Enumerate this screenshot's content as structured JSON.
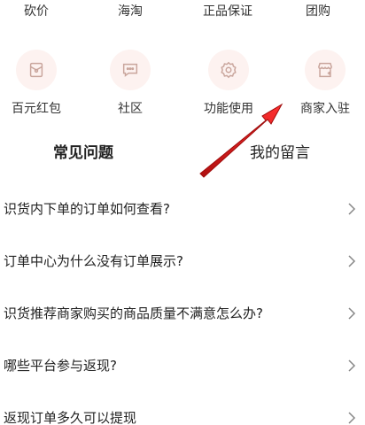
{
  "top_row": [
    {
      "label": "砍价"
    },
    {
      "label": "海淘"
    },
    {
      "label": "正品保证"
    },
    {
      "label": "团购"
    }
  ],
  "grid_row": [
    {
      "label": "百元红包",
      "icon": "red-envelope-icon"
    },
    {
      "label": "社区",
      "icon": "chat-bubble-icon"
    },
    {
      "label": "功能使用",
      "icon": "gear-icon"
    },
    {
      "label": "商家入驻",
      "icon": "shop-icon"
    }
  ],
  "tabs": [
    {
      "label": "常见问题",
      "active": true
    },
    {
      "label": "我的留言",
      "active": false
    }
  ],
  "faq": [
    {
      "question": "识货内下单的订单如何查看?"
    },
    {
      "question": "订单中心为什么没有订单展示?"
    },
    {
      "question": "识货推荐商家购买的商品质量不满意怎么办?"
    },
    {
      "question": "哪些平台参与返现?"
    },
    {
      "question": "返现订单多久可以提现"
    }
  ],
  "colors": {
    "icon_stroke": "#c9a59c",
    "icon_bg": "#fdf2f0",
    "arrow": "#e02020",
    "chevron": "#888888"
  }
}
